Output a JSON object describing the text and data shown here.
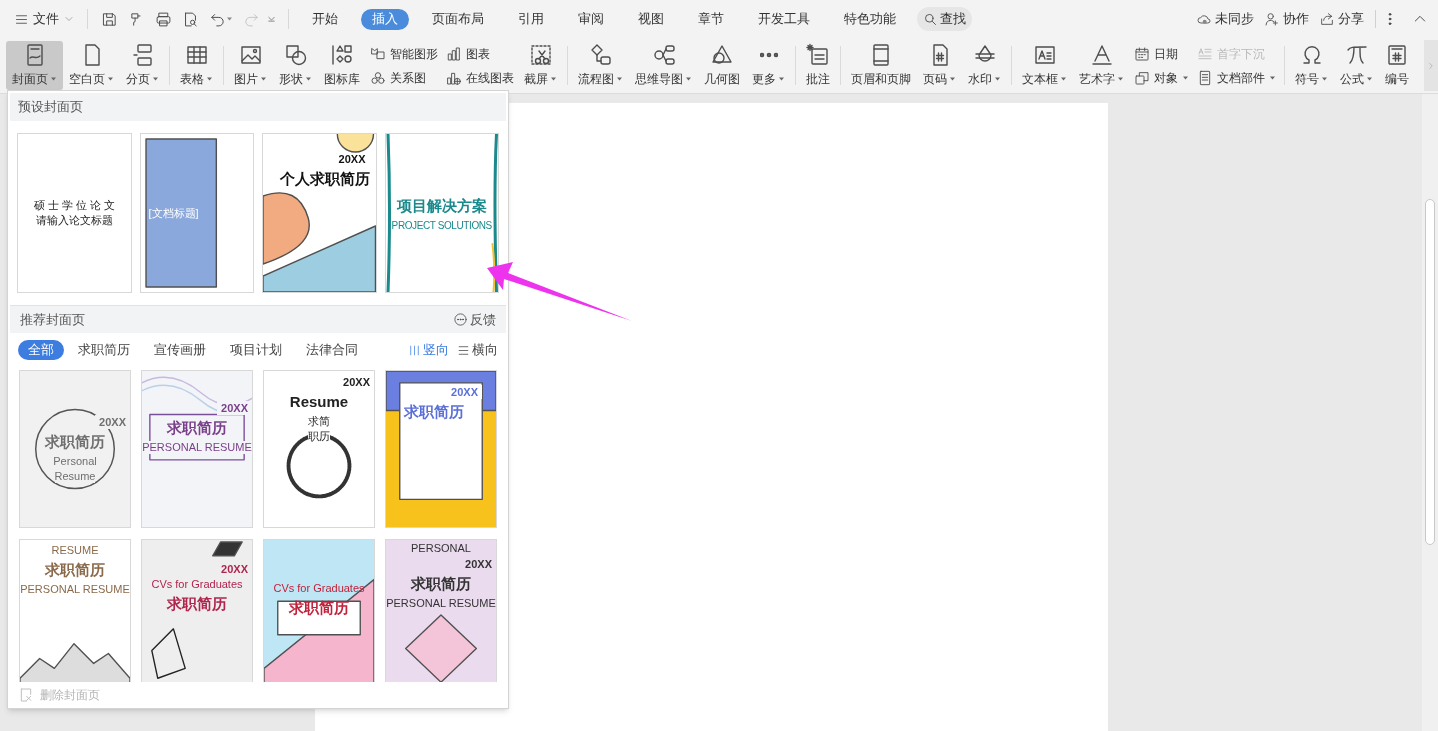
{
  "menu_bar": {
    "file_menu": {
      "label": "文件"
    },
    "tabs": [
      {
        "label": "开始",
        "selected": false
      },
      {
        "label": "插入",
        "selected": true
      },
      {
        "label": "页面布局",
        "selected": false
      },
      {
        "label": "引用",
        "selected": false
      },
      {
        "label": "审阅",
        "selected": false
      },
      {
        "label": "视图",
        "selected": false
      },
      {
        "label": "章节",
        "selected": false
      },
      {
        "label": "开发工具",
        "selected": false
      },
      {
        "label": "特色功能",
        "selected": false
      }
    ],
    "search": {
      "label": "查找"
    },
    "actions": [
      {
        "label": "未同步"
      },
      {
        "label": "协作"
      },
      {
        "label": "分享"
      }
    ]
  },
  "ribbon": {
    "groups": [
      {
        "items": [
          {
            "kind": "large",
            "label": "封面页",
            "dropdown": true,
            "selected": true
          },
          {
            "kind": "large",
            "label": "空白页",
            "dropdown": true,
            "selected": false
          },
          {
            "kind": "large",
            "label": "分页",
            "dropdown": true,
            "selected": false
          }
        ]
      },
      {
        "items": [
          {
            "kind": "large",
            "label": "表格",
            "dropdown": true,
            "selected": false
          }
        ]
      },
      {
        "items": [
          {
            "kind": "large",
            "label": "图片",
            "dropdown": true,
            "selected": false
          },
          {
            "kind": "large",
            "label": "形状",
            "dropdown": true,
            "selected": false
          },
          {
            "kind": "large",
            "label": "图标库",
            "dropdown": false,
            "selected": false
          },
          {
            "kind": "stack",
            "items": [
              {
                "label": "智能图形",
                "dropdown": false,
                "disabled": false
              },
              {
                "label": "关系图",
                "dropdown": false,
                "disabled": false
              }
            ]
          },
          {
            "kind": "stack",
            "items": [
              {
                "label": "图表",
                "dropdown": false,
                "disabled": false
              },
              {
                "label": "在线图表",
                "dropdown": false,
                "disabled": false
              }
            ]
          },
          {
            "kind": "large",
            "label": "截屏",
            "dropdown": true,
            "selected": false
          }
        ]
      },
      {
        "items": [
          {
            "kind": "large",
            "label": "流程图",
            "dropdown": true,
            "selected": false
          },
          {
            "kind": "large",
            "label": "思维导图",
            "dropdown": true,
            "selected": false
          },
          {
            "kind": "large",
            "label": "几何图",
            "dropdown": false,
            "selected": false
          },
          {
            "kind": "large",
            "label": "更多",
            "dropdown": true,
            "selected": false
          }
        ]
      },
      {
        "items": [
          {
            "kind": "large",
            "label": "批注",
            "dropdown": false,
            "selected": false
          }
        ]
      },
      {
        "items": [
          {
            "kind": "large",
            "label": "页眉和页脚",
            "dropdown": false,
            "selected": false
          },
          {
            "kind": "large",
            "label": "页码",
            "dropdown": true,
            "selected": false
          },
          {
            "kind": "large",
            "label": "水印",
            "dropdown": true,
            "selected": false
          }
        ]
      },
      {
        "items": [
          {
            "kind": "large",
            "label": "文本框",
            "dropdown": true,
            "selected": false
          },
          {
            "kind": "large",
            "label": "艺术字",
            "dropdown": true,
            "selected": false
          },
          {
            "kind": "stack",
            "items": [
              {
                "label": "日期",
                "dropdown": false,
                "disabled": false
              },
              {
                "label": "对象",
                "dropdown": true,
                "disabled": false
              }
            ]
          },
          {
            "kind": "stack",
            "items": [
              {
                "label": "首字下沉",
                "dropdown": false,
                "disabled": true
              },
              {
                "label": "文档部件",
                "dropdown": true,
                "disabled": false
              }
            ]
          }
        ]
      },
      {
        "items": [
          {
            "kind": "large",
            "label": "符号",
            "dropdown": true,
            "selected": false
          },
          {
            "kind": "large",
            "label": "公式",
            "dropdown": true,
            "selected": false
          },
          {
            "kind": "large",
            "label": "编号",
            "dropdown": false,
            "selected": false
          }
        ]
      }
    ]
  },
  "cover_menu": {
    "preset_heading": "预设封面页",
    "presets": [
      {
        "kind": "thesis",
        "lines": [
          {
            "kind": "caption",
            "text": "硕 士 学 位 论 文"
          },
          {
            "kind": "caption",
            "text": "请输入论文标题"
          }
        ]
      },
      {
        "kind": "band",
        "lines": [
          {
            "kind": "caption",
            "text": "[文档标题]"
          }
        ]
      },
      {
        "kind": "blobs",
        "lines": [
          {
            "kind": "year",
            "text": "20XX"
          },
          {
            "kind": "title",
            "text": "个人求职简历"
          }
        ]
      },
      {
        "kind": "teal",
        "lines": [
          {
            "kind": "title",
            "text": "项目解决方案"
          },
          {
            "kind": "caption",
            "text": "PROJECT SOLUTIONS"
          }
        ]
      }
    ],
    "recommended_heading": "推荐封面页",
    "feedback": {
      "label": "反馈"
    },
    "filters": [
      {
        "label": "全部",
        "selected": true
      },
      {
        "label": "求职简历",
        "selected": false
      },
      {
        "label": "宣传画册",
        "selected": false
      },
      {
        "label": "项目计划",
        "selected": false
      },
      {
        "label": "法律合同",
        "selected": false
      }
    ],
    "orientations": [
      {
        "label": "竖向",
        "selected": true
      },
      {
        "label": "横向",
        "selected": false
      }
    ],
    "templates": [
      {
        "kind": "circle",
        "lines": [
          {
            "kind": "year",
            "text": "20XX"
          },
          {
            "kind": "title",
            "text": "求职简历"
          },
          {
            "kind": "caption",
            "text": "Personal"
          },
          {
            "kind": "caption",
            "text": "Resume"
          }
        ]
      },
      {
        "kind": "waves",
        "lines": [
          {
            "kind": "year",
            "text": "20XX"
          },
          {
            "kind": "title",
            "text": "求职简历"
          },
          {
            "kind": "caption",
            "text": "PERSONAL RESUME"
          }
        ]
      },
      {
        "kind": "stamp",
        "lines": [
          {
            "kind": "year",
            "text": "20XX"
          },
          {
            "kind": "title",
            "text": "Resume"
          },
          {
            "kind": "caption",
            "text": "求简"
          },
          {
            "kind": "caption",
            "text": "职历"
          }
        ]
      },
      {
        "kind": "blue-yellow",
        "lines": [
          {
            "kind": "year",
            "text": "20XX"
          },
          {
            "kind": "title",
            "text": "求职简历"
          }
        ]
      },
      {
        "kind": "ink",
        "lines": [
          {
            "kind": "caption",
            "text": "RESUME"
          },
          {
            "kind": "title",
            "text": "求职简历"
          },
          {
            "kind": "caption",
            "text": "PERSONAL RESUME"
          }
        ]
      },
      {
        "kind": "geometric",
        "lines": [
          {
            "kind": "year",
            "text": "20XX"
          },
          {
            "kind": "caption",
            "text": "CVs for Graduates"
          },
          {
            "kind": "title",
            "text": "求职简历"
          }
        ]
      },
      {
        "kind": "pink-blue",
        "lines": [
          {
            "kind": "caption",
            "text": "CVs for Graduates"
          },
          {
            "kind": "title",
            "text": "求职简历"
          }
        ]
      },
      {
        "kind": "pastel",
        "lines": [
          {
            "kind": "caption",
            "text": "PERSONAL"
          },
          {
            "kind": "year",
            "text": "20XX"
          },
          {
            "kind": "title",
            "text": "求职简历"
          },
          {
            "kind": "caption",
            "text": "PERSONAL RESUME"
          }
        ]
      }
    ],
    "remove": {
      "label": "删除封面页",
      "disabled": true
    }
  }
}
